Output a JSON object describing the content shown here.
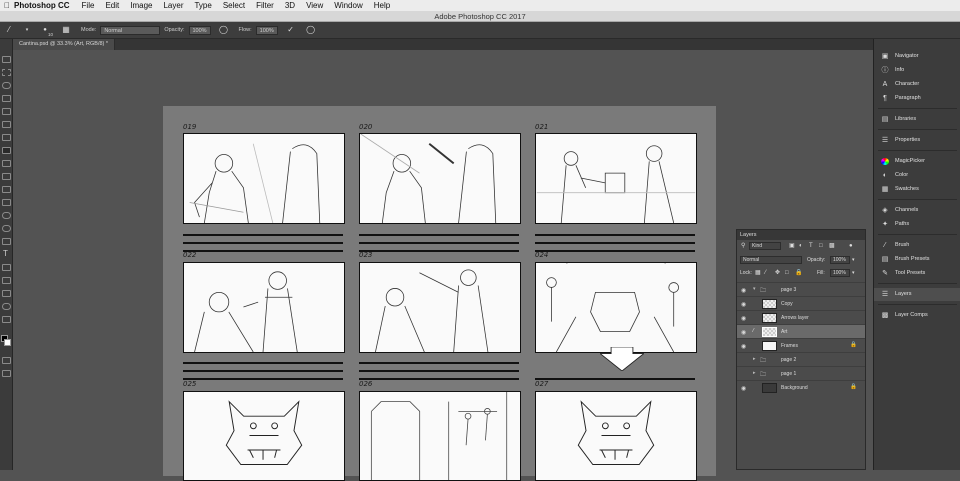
{
  "menubar": {
    "app_name": "Photoshop CC",
    "items": [
      "File",
      "Edit",
      "Image",
      "Layer",
      "Type",
      "Select",
      "Filter",
      "3D",
      "View",
      "Window",
      "Help"
    ]
  },
  "window_title": "Adobe Photoshop CC 2017",
  "options_bar": {
    "brush_size": "10",
    "mode_label": "Mode:",
    "mode_value": "Normal",
    "opacity_label": "Opacity:",
    "opacity_value": "100%",
    "flow_label": "Flow:",
    "flow_value": "100%"
  },
  "document_tab": "Cantina.psd @ 33.3% (Art, RGB/8) *",
  "storyboard": {
    "frame_numbers": [
      "019",
      "020",
      "021",
      "022",
      "023",
      "024",
      "025",
      "026",
      "027"
    ]
  },
  "dock": {
    "items": [
      {
        "label": "Navigator",
        "icon": "navigator-icon"
      },
      {
        "label": "Info",
        "icon": "info-icon"
      },
      {
        "label": "Character",
        "icon": "character-icon"
      },
      {
        "label": "Paragraph",
        "icon": "paragraph-icon"
      },
      {
        "label": "Libraries",
        "icon": "libraries-icon"
      },
      {
        "label": "Properties",
        "icon": "properties-icon"
      },
      {
        "label": "MagicPicker",
        "icon": "magicpicker-icon"
      },
      {
        "label": "Color",
        "icon": "color-icon"
      },
      {
        "label": "Swatches",
        "icon": "swatches-icon"
      },
      {
        "label": "Channels",
        "icon": "channels-icon"
      },
      {
        "label": "Paths",
        "icon": "paths-icon"
      },
      {
        "label": "Brush",
        "icon": "brush-icon"
      },
      {
        "label": "Brush Presets",
        "icon": "brush-presets-icon"
      },
      {
        "label": "Tool Presets",
        "icon": "tool-presets-icon"
      },
      {
        "label": "Layers",
        "icon": "layers-icon"
      },
      {
        "label": "Layer Comps",
        "icon": "layer-comps-icon"
      }
    ]
  },
  "layers_panel": {
    "title": "Layers",
    "filter_kind": "Kind",
    "blend_mode": "Normal",
    "opacity_label": "Opacity:",
    "opacity_value": "100%",
    "lock_label": "Lock:",
    "fill_label": "Fill:",
    "fill_value": "100%",
    "layers": [
      {
        "name": "page 3",
        "type": "group",
        "visible": true
      },
      {
        "name": "Copy",
        "type": "layer",
        "visible": true
      },
      {
        "name": "Arrows layer",
        "type": "layer",
        "visible": true
      },
      {
        "name": "Art",
        "type": "layer",
        "visible": true,
        "selected": true
      },
      {
        "name": "Frames",
        "type": "layer",
        "visible": true,
        "locked": true
      },
      {
        "name": "page 2",
        "type": "group",
        "visible": false
      },
      {
        "name": "page 1",
        "type": "group",
        "visible": false
      },
      {
        "name": "Background",
        "type": "layer",
        "visible": true,
        "locked": true
      }
    ]
  },
  "colors": {
    "accent": "#2d8ceb",
    "canvas_bg": "#535353",
    "document_bg": "#7a7a7a"
  }
}
